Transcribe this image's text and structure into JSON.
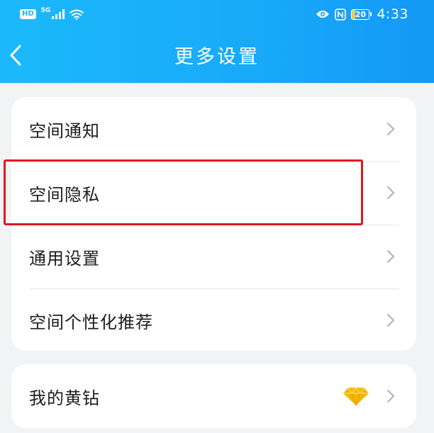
{
  "status_bar": {
    "hd": "HD",
    "signal": "5G",
    "battery": "20",
    "battery_level": 0.2,
    "time": "4:33"
  },
  "header": {
    "title": "更多设置",
    "back_icon": "chevron-left-icon"
  },
  "menu": {
    "group1": [
      {
        "label": "空间通知"
      },
      {
        "label": "空间隐私"
      },
      {
        "label": "通用设置"
      },
      {
        "label": "空间个性化推荐"
      }
    ],
    "group2": [
      {
        "label": "我的黄钻",
        "icon": "diamond-icon"
      }
    ]
  },
  "highlight": {
    "target": "空间隐私",
    "color": "#e3161e"
  },
  "colors": {
    "header": "#18a9f9",
    "accent": "#f5b600"
  }
}
